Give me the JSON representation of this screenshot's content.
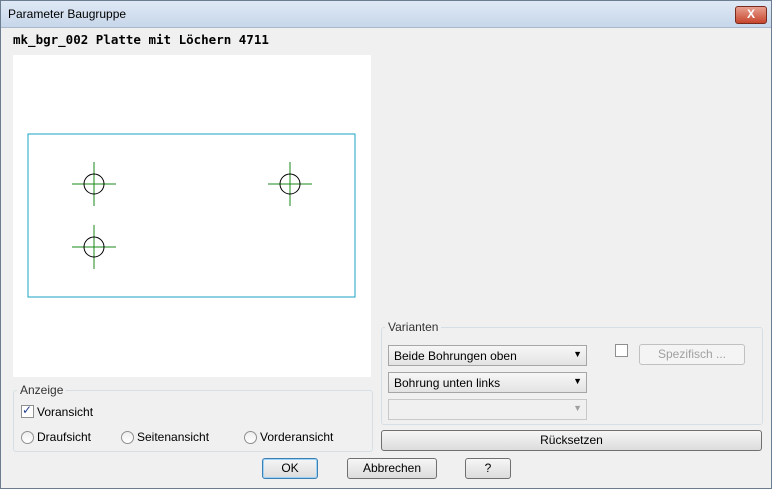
{
  "window": {
    "title": "Parameter Baugruppe",
    "close_symbol": "X"
  },
  "heading": "mk_bgr_002 Platte mit Löchern 4711",
  "preview": {
    "plate_color": "#1aa3c4",
    "crosshair_color": "#1a8a1a",
    "hole_color": "#000000"
  },
  "anzeige": {
    "legend": "Anzeige",
    "voransicht_label": "Voransicht",
    "voransicht_checked": true,
    "draufsicht_label": "Draufsicht",
    "seitenansicht_label": "Seitenansicht",
    "vorderansicht_label": "Vorderansicht"
  },
  "varianten": {
    "legend": "Varianten",
    "select1_value": "Beide Bohrungen oben",
    "select2_value": "Bohrung unten links",
    "select3_value": "",
    "spezifisch_label": "Spezifisch ...",
    "ruecksetzen_label": "Rücksetzen"
  },
  "footer": {
    "ok_label": "OK",
    "cancel_label": "Abbrechen",
    "help_label": "?"
  }
}
